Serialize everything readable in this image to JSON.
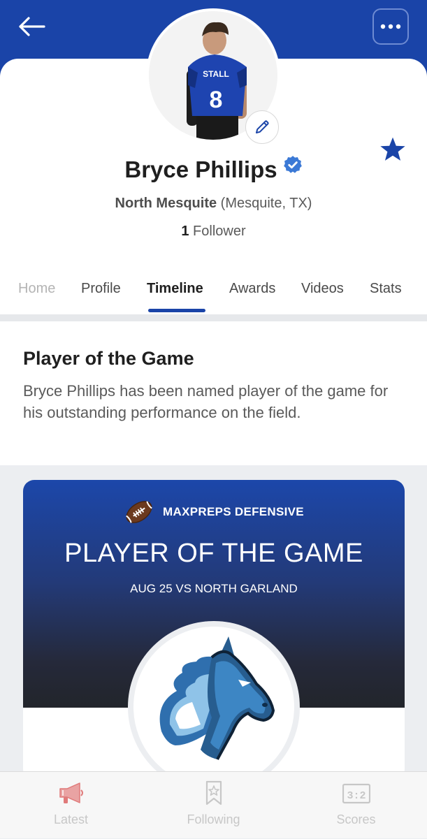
{
  "header": {
    "back_icon": "arrow-left-icon",
    "more_icon": "ellipsis-icon"
  },
  "profile": {
    "name": "Bryce Phillips",
    "school": "North Mesquite",
    "location": "(Mesquite, TX)",
    "follower_count": "1",
    "follower_label": "Follower",
    "jersey_number": "8",
    "jersey_text": "STALL"
  },
  "tabs": [
    {
      "label": "Home"
    },
    {
      "label": "Profile"
    },
    {
      "label": "Timeline"
    },
    {
      "label": "Awards"
    },
    {
      "label": "Videos"
    },
    {
      "label": "Stats"
    }
  ],
  "active_tab": "Timeline",
  "post": {
    "title": "Player of the Game",
    "body": "Bryce Phillips has been named player of the game for his outstanding performance on the field."
  },
  "award_card": {
    "brand": "MAXPREPS DEFENSIVE",
    "headline": "PLAYER OF THE GAME",
    "game": "AUG 25 VS NORTH GARLAND"
  },
  "bottom_nav": [
    {
      "label": "Latest",
      "icon": "megaphone-icon"
    },
    {
      "label": "Following",
      "icon": "bookmark-star-icon"
    },
    {
      "label": "Scores",
      "icon": "scoreboard-icon",
      "icon_text": "3:2"
    }
  ],
  "colors": {
    "brand_blue": "#1a44a8",
    "verified_blue": "#3b79d6",
    "latest_red": "#e07a7a"
  }
}
